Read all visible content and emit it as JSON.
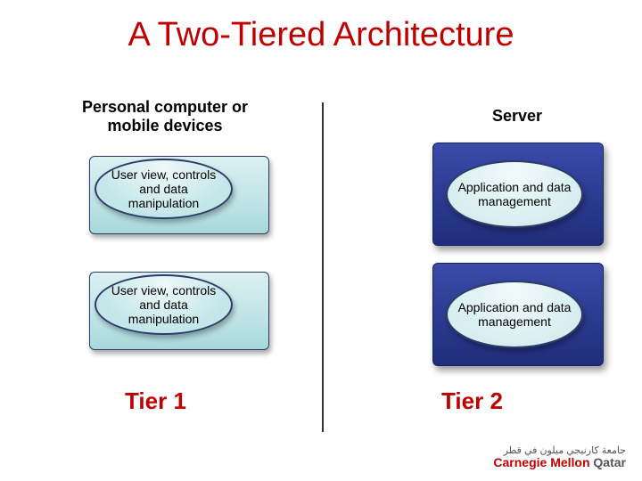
{
  "title": "A Two-Tiered Architecture",
  "columns": {
    "left_header": "Personal computer or mobile devices",
    "right_header": "Server"
  },
  "left_boxes": [
    "User view, controls and data manipulation",
    "User view, controls and data manipulation"
  ],
  "right_boxes": [
    "Application and data management",
    "Application and data management"
  ],
  "tiers": {
    "left": "Tier 1",
    "right": "Tier 2"
  },
  "logo": {
    "arabic": "جامعة كارنيجي ميلون في قطر",
    "english_main": "Carnegie Mellon",
    "english_sub": "Qatar"
  }
}
